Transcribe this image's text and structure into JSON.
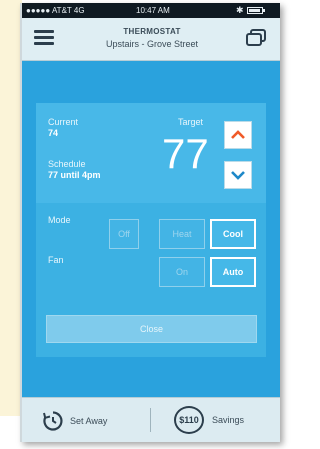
{
  "status_bar": {
    "carrier": "●●●●● AT&T  4G",
    "time": "10:47 AM"
  },
  "header": {
    "title": "THERMOSTAT",
    "subtitle": "Upstairs - Grove Street"
  },
  "thermostat": {
    "current_label": "Current",
    "current_value": "74",
    "schedule_label": "Schedule",
    "schedule_value": "77 until 4pm",
    "target_label": "Target",
    "target_value": "77"
  },
  "mode": {
    "label": "Mode",
    "options": [
      "Off",
      "Heat",
      "Cool"
    ],
    "selected": "Cool"
  },
  "fan": {
    "label": "Fan",
    "options": [
      "On",
      "Auto"
    ],
    "selected": "Auto"
  },
  "close_label": "Close",
  "footer": {
    "set_away_label": "Set Away",
    "savings_amount": "$110",
    "savings_label": "Savings"
  },
  "colors": {
    "background": "#2aa2dd",
    "panel": "#3cb1e3",
    "up_arrow": "#f05a28",
    "down_arrow": "#1e88c8",
    "header_bg": "#dfeef3",
    "side_bar": "#fbf4d8"
  },
  "icons": {
    "menu": "hamburger-menu-icon",
    "devices": "devices-icon",
    "up": "chevron-up-icon",
    "down": "chevron-down-icon",
    "away": "away-timer-icon",
    "bluetooth": "bluetooth-icon",
    "battery": "battery-icon"
  }
}
